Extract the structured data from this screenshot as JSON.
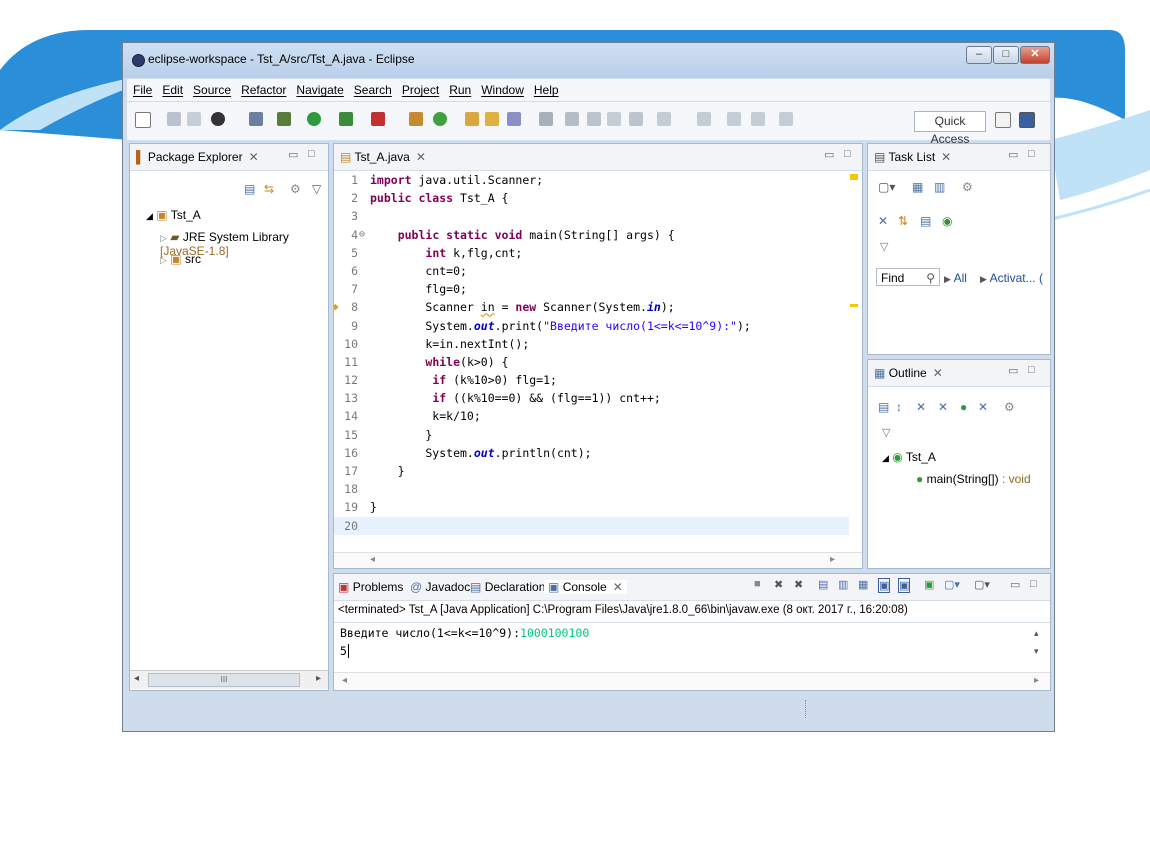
{
  "window": {
    "title": "eclipse-workspace - Tst_A/src/Tst_A.java - Eclipse"
  },
  "menu": [
    "File",
    "Edit",
    "Source",
    "Refactor",
    "Navigate",
    "Search",
    "Project",
    "Run",
    "Window",
    "Help"
  ],
  "toolbar": {
    "quick_access": "Quick Access"
  },
  "package_explorer": {
    "tab": "Package Explorer",
    "project": "Tst_A",
    "items": [
      {
        "label": "JRE System Library",
        "suffix": "[JavaSE-1.8]"
      },
      {
        "label": "src"
      }
    ],
    "hscroll_grip": "III"
  },
  "editor": {
    "tab": "Tst_A.java",
    "lines": [
      "1",
      "2",
      "3",
      "4",
      "5",
      "6",
      "7",
      "8",
      "9",
      "10",
      "11",
      "12",
      "13",
      "14",
      "15",
      "16",
      "17",
      "18",
      "19",
      "20"
    ]
  },
  "task_list": {
    "tab": "Task List",
    "find": "Find",
    "all": "All",
    "activate": "Activat...",
    "paren": "("
  },
  "outline": {
    "tab": "Outline",
    "class_name": "Tst_A",
    "method": "main(String[])",
    "method_type": " : void"
  },
  "bottom": {
    "tabs": [
      "Problems",
      "Javadoc",
      "Declaration",
      "Console"
    ],
    "terminated": "<terminated> Tst_A [Java Application] C:\\Program Files\\Java\\jre1.8.0_66\\bin\\javaw.exe (8 окт. 2017 г., 16:20:08)",
    "prompt": "Введите число(1<=k<=10^9):",
    "input": "1000100100",
    "output": "5"
  },
  "colors": {
    "accent": "#2a8fd8",
    "keyword": "#7f0055",
    "string": "#2a00ff",
    "console_input": "#00c87a"
  }
}
